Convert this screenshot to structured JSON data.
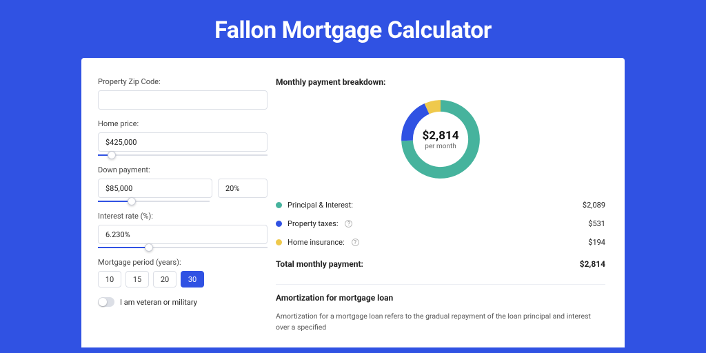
{
  "title": "Fallon Mortgage Calculator",
  "form": {
    "zip": {
      "label": "Property Zip Code:",
      "value": ""
    },
    "price": {
      "label": "Home price:",
      "value": "$425,000",
      "slider_pct": 8
    },
    "down": {
      "label": "Down payment:",
      "amount": "$85,000",
      "pct": "20%",
      "slider_pct": 20
    },
    "rate": {
      "label": "Interest rate (%):",
      "value": "6.230%",
      "slider_pct": 30
    },
    "period": {
      "label": "Mortgage period (years):",
      "options": [
        "10",
        "15",
        "20",
        "30"
      ],
      "active": "30"
    },
    "veteran": {
      "label": "I am veteran or military",
      "on": false
    }
  },
  "breakdown": {
    "title": "Monthly payment breakdown:",
    "center_amount": "$2,814",
    "center_sub": "per month",
    "rows": [
      {
        "dot": "#46b39d",
        "label": "Principal & Interest:",
        "value": "$2,089",
        "help": false
      },
      {
        "dot": "#3052e3",
        "label": "Property taxes:",
        "value": "$531",
        "help": true
      },
      {
        "dot": "#efc94c",
        "label": "Home insurance:",
        "value": "$194",
        "help": true
      }
    ],
    "total_label": "Total monthly payment:",
    "total_value": "$2,814"
  },
  "amort": {
    "title": "Amortization for mortgage loan",
    "body": "Amortization for a mortgage loan refers to the gradual repayment of the loan principal and interest over a specified"
  },
  "chart_data": {
    "type": "pie",
    "title": "Monthly payment breakdown",
    "series": [
      {
        "name": "Principal & Interest",
        "value": 2089,
        "color": "#46b39d"
      },
      {
        "name": "Property taxes",
        "value": 531,
        "color": "#3052e3"
      },
      {
        "name": "Home insurance",
        "value": 194,
        "color": "#efc94c"
      }
    ],
    "total": 2814,
    "center_label": "$2,814 per month"
  }
}
